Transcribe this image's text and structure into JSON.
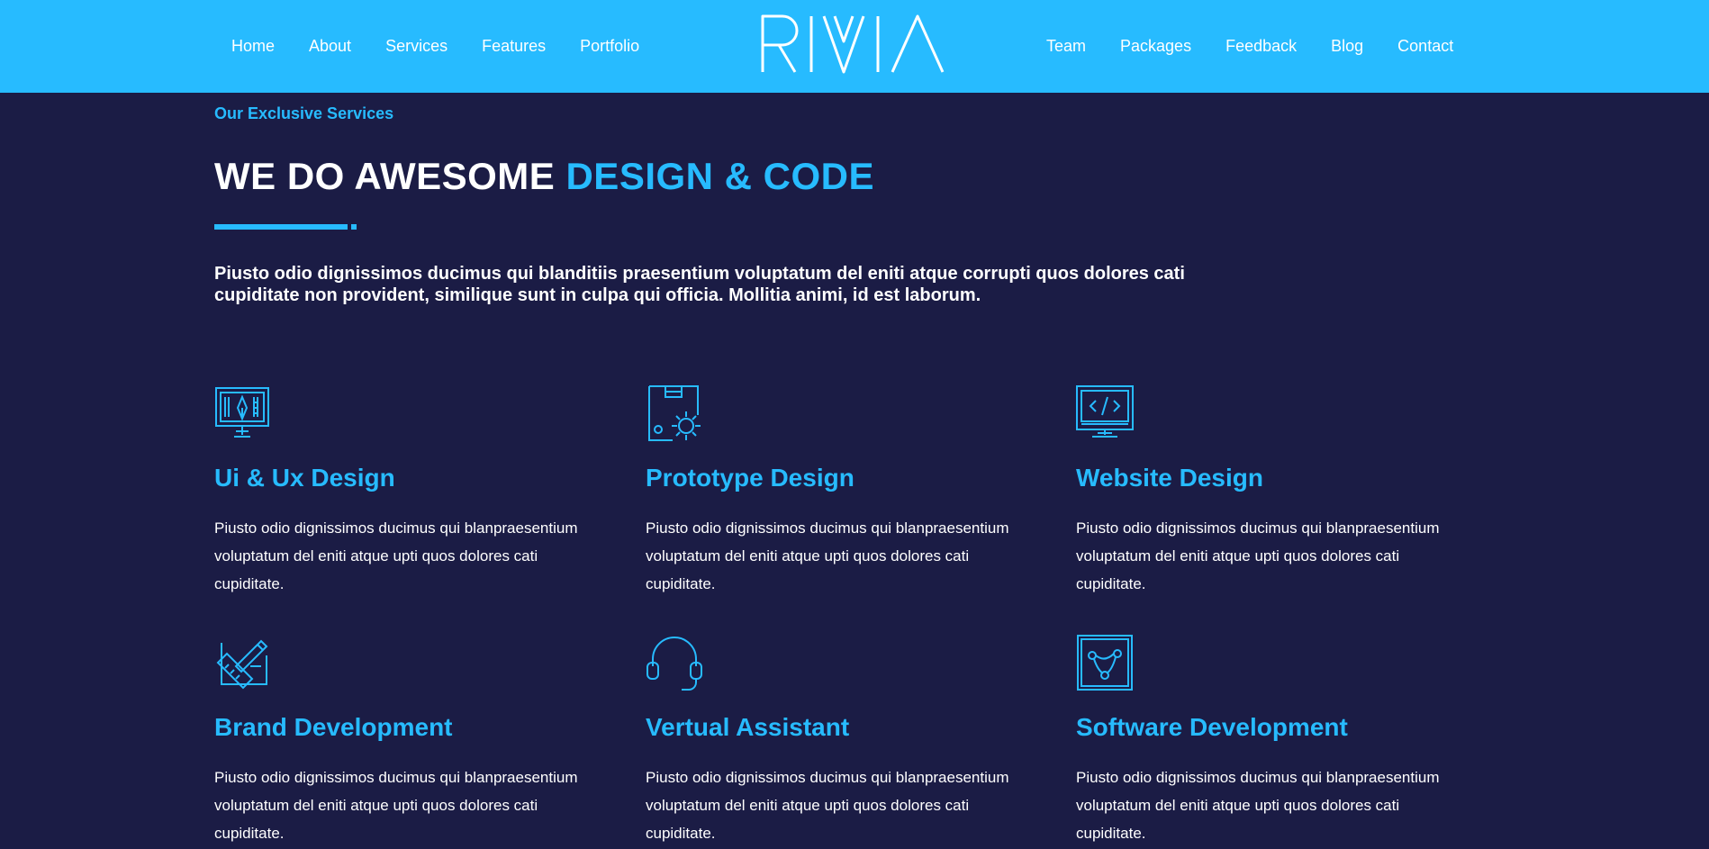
{
  "nav": {
    "left": [
      "Home",
      "About",
      "Services",
      "Features",
      "Portfolio"
    ],
    "right": [
      "Team",
      "Packages",
      "Feedback",
      "Blog",
      "Contact"
    ]
  },
  "brand": {
    "logo_text": "RIVIA"
  },
  "intro": {
    "eyebrow": "Our Exclusive Services",
    "headline_plain": "WE DO AWESOME",
    "headline_accent": "DESIGN & CODE",
    "body": "Piusto odio dignissimos ducimus qui blanditiis praesentium voluptatum del eniti atque corrupti quos dolores cati cupiditate non provident, similique sunt in culpa qui officia. Mollitia animi, id est laborum."
  },
  "services": [
    {
      "icon": "design-monitor-icon",
      "title": "Ui & Ux Design",
      "desc": "Piusto odio dignissimos ducimus qui blanpraesentium voluptatum del eniti atque upti quos dolores cati cupiditate."
    },
    {
      "icon": "prototype-gear-icon",
      "title": "Prototype Design",
      "desc": "Piusto odio dignissimos ducimus qui blanpraesentium voluptatum del eniti atque upti quos dolores cati cupiditate."
    },
    {
      "icon": "code-monitor-icon",
      "title": "Website Design",
      "desc": "Piusto odio dignissimos ducimus qui blanpraesentium voluptatum del eniti atque upti quos dolores cati cupiditate."
    },
    {
      "icon": "brand-pen-icon",
      "title": "Brand Development",
      "desc": "Piusto odio dignissimos ducimus qui blanpraesentium voluptatum del eniti atque upti quos dolores cati cupiditate."
    },
    {
      "icon": "headset-icon",
      "title": "Vertual Assistant",
      "desc": "Piusto odio dignissimos ducimus qui blanpraesentium voluptatum del eniti atque upti quos dolores cati cupiditate."
    },
    {
      "icon": "software-nodes-icon",
      "title": "Software Development",
      "desc": "Piusto odio dignissimos ducimus qui blanpraesentium voluptatum del eniti atque upti quos dolores cati cupiditate."
    }
  ],
  "colors": {
    "header": "#27bbff",
    "background": "#1b1c45",
    "accent": "#27bbff",
    "text": "#ffffff"
  }
}
